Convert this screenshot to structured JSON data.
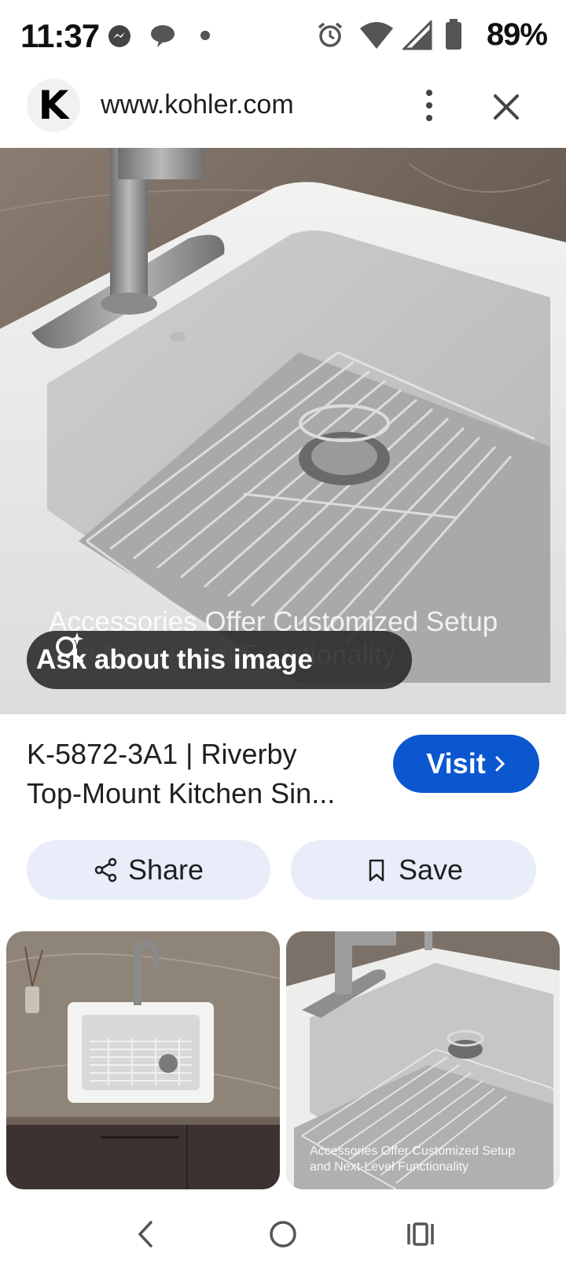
{
  "status_bar": {
    "time": "11:37",
    "battery": "89%",
    "icons": [
      "messenger-icon",
      "chat-icon",
      "dot-icon",
      "alarm-icon",
      "wifi-icon",
      "signal-icon",
      "battery-icon"
    ]
  },
  "browser": {
    "site_logo_letter": "K",
    "url": "www.kohler.com"
  },
  "hero": {
    "caption": "Accessories Offer Customized Setup and Next-Level Functionality",
    "ask_label": "Ask about this image"
  },
  "result": {
    "title_line1": "K-5872-3A1 | Riverby",
    "title_line2": "Top-Mount Kitchen Sin...",
    "visit_label": "Visit"
  },
  "actions": {
    "share_label": "Share",
    "save_label": "Save"
  },
  "thumbnails": {
    "second_caption": "Accessories Offer Customized Setup and Next-Level Functionality"
  },
  "colors": {
    "accent": "#0b57d0",
    "action_bg": "#e8edf9",
    "pill_bg": "#282828"
  }
}
